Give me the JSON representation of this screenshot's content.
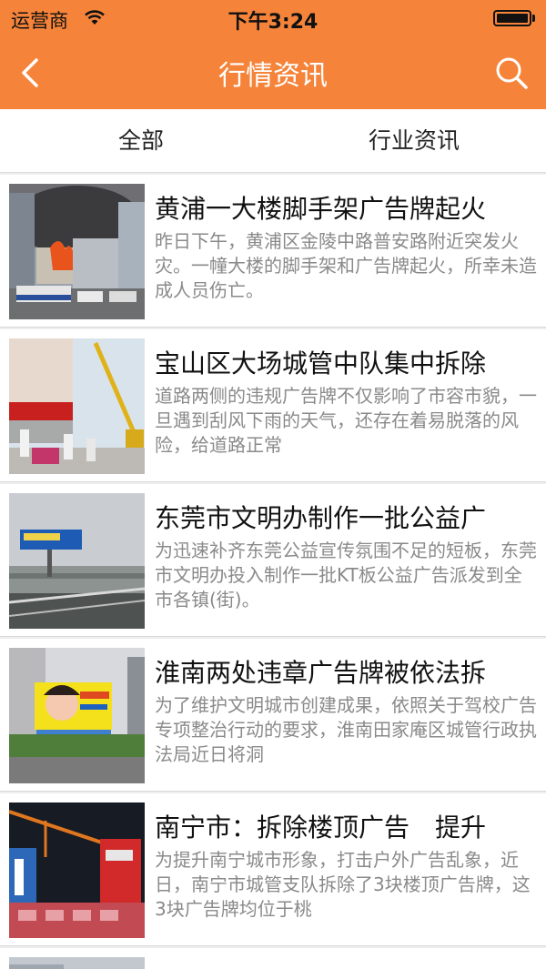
{
  "status": {
    "carrier": "运营商",
    "time": "下午3:24"
  },
  "nav": {
    "title": "行情资讯"
  },
  "tabs": [
    {
      "label": "全部"
    },
    {
      "label": "行业资讯"
    }
  ],
  "articles": [
    {
      "title": "黄浦一大楼脚手架广告牌起火",
      "desc": "昨日下午，黄浦区金陵中路普安路附近突发火灾。一幢大楼的脚手架和广告牌起火，所幸未造成人员伤亡。"
    },
    {
      "title": "宝山区大场城管中队集中拆除",
      "desc": "道路两侧的违规广告牌不仅影响了市容市貌，一旦遇到刮风下雨的天气，还存在着易脱落的风险，给道路正常"
    },
    {
      "title": "东莞市文明办制作一批公益广",
      "desc": "为迅速补齐东莞公益宣传氛围不足的短板，东莞市文明办投入制作一批KT板公益广告派发到全市各镇(街)。"
    },
    {
      "title": "淮南两处违章广告牌被依法拆",
      "desc": "为了维护文明城市创建成果，依照关于驾校广告专项整治行动的要求，淮南田家庵区城管行政执法局近日将洞"
    },
    {
      "title": "南宁市：拆除楼顶广告　提升",
      "desc": "为提升南宁城市形象，打击户外广告乱象，近日，南宁市城管支队拆除了3块楼顶广告牌，这3块广告牌均位于桃"
    }
  ]
}
